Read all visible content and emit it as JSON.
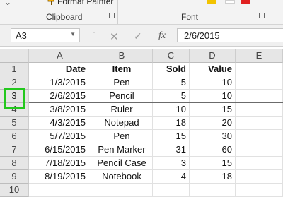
{
  "ribbon": {
    "format_painter_label": "Format Painter",
    "clipboard_label": "Clipboard",
    "font_label": "Font",
    "colors": {
      "highlight": "#f2c300",
      "font_color": "#e02020"
    }
  },
  "formula_bar": {
    "name_box": "A3",
    "cancel_symbol": "✕",
    "enter_symbol": "✓",
    "fx_label": "fx",
    "value": "2/6/2015"
  },
  "grid": {
    "columns": [
      "A",
      "B",
      "C",
      "D",
      "E"
    ],
    "rows": [
      {
        "num": "1",
        "a": "Date",
        "b": "Item",
        "c": "Sold",
        "d": "Value"
      },
      {
        "num": "2",
        "a": "1/3/2015",
        "b": "Pen",
        "c": "5",
        "d": "10"
      },
      {
        "num": "3",
        "a": "2/6/2015",
        "b": "Pencil",
        "c": "5",
        "d": "10"
      },
      {
        "num": "4",
        "a": "3/8/2015",
        "b": "Ruler",
        "c": "10",
        "d": "15"
      },
      {
        "num": "5",
        "a": "4/3/2015",
        "b": "Notepad",
        "c": "18",
        "d": "20"
      },
      {
        "num": "6",
        "a": "5/7/2015",
        "b": "Pen",
        "c": "15",
        "d": "30"
      },
      {
        "num": "7",
        "a": "6/15/2015",
        "b": "Pen Marker",
        "c": "31",
        "d": "60"
      },
      {
        "num": "8",
        "a": "7/18/2015",
        "b": "Pencil Case",
        "c": "3",
        "d": "15"
      },
      {
        "num": "9",
        "a": "8/19/2015",
        "b": "Notebook",
        "c": "4",
        "d": "18"
      },
      {
        "num": "10",
        "a": "",
        "b": "",
        "c": "",
        "d": ""
      }
    ],
    "selected_row": "3",
    "highlight_color": "#23c81d"
  }
}
